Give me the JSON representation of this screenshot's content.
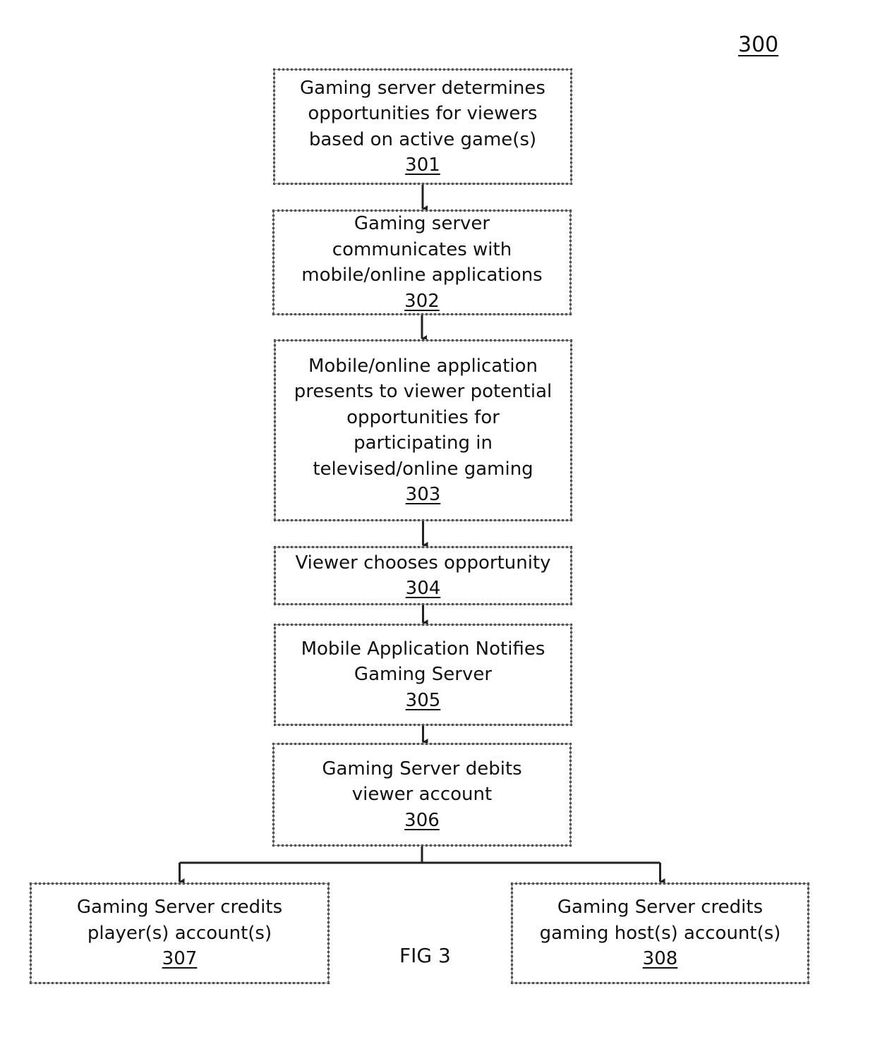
{
  "figure": {
    "number": "300",
    "caption": "FIG 3"
  },
  "steps": [
    {
      "id": "301",
      "lines": [
        "Gaming server determines",
        "opportunities for viewers",
        "based on active game(s)"
      ]
    },
    {
      "id": "302",
      "lines": [
        "Gaming server",
        "communicates with",
        "mobile/online applications"
      ]
    },
    {
      "id": "303",
      "lines": [
        "Mobile/online application",
        "presents to viewer potential",
        "opportunities for",
        "participating in",
        "televised/online gaming"
      ]
    },
    {
      "id": "304",
      "lines": [
        "Viewer chooses opportunity"
      ]
    },
    {
      "id": "305",
      "lines": [
        "Mobile Application Notifies",
        "Gaming Server"
      ]
    },
    {
      "id": "306",
      "lines": [
        "Gaming Server debits",
        "viewer account"
      ]
    },
    {
      "id": "307",
      "lines": [
        "Gaming Server credits",
        "player(s) account(s)"
      ]
    },
    {
      "id": "308",
      "lines": [
        "Gaming Server credits",
        "gaming host(s) account(s)"
      ]
    }
  ],
  "edges": [
    {
      "from": "301",
      "to": "302"
    },
    {
      "from": "302",
      "to": "303"
    },
    {
      "from": "303",
      "to": "304"
    },
    {
      "from": "304",
      "to": "305"
    },
    {
      "from": "305",
      "to": "306"
    },
    {
      "from": "306",
      "to": "307"
    },
    {
      "from": "306",
      "to": "308"
    }
  ]
}
